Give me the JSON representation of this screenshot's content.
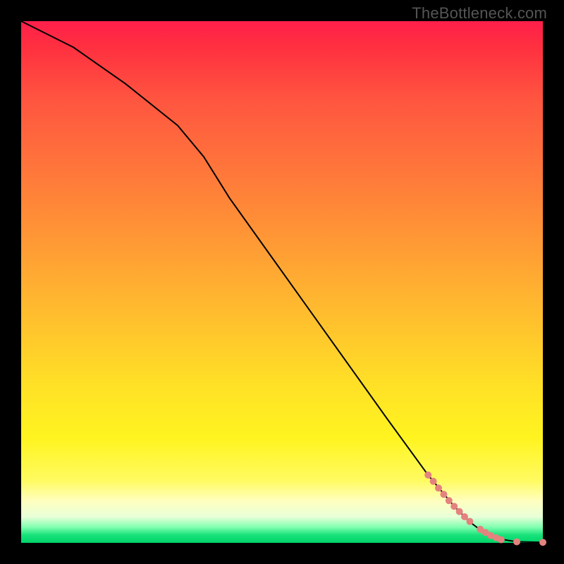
{
  "watermark": "TheBottleneck.com",
  "colors": {
    "line": "#000000",
    "dot_fill": "#e4827e",
    "dot_stroke": "#c96a65"
  },
  "chart_data": {
    "type": "line",
    "title": "",
    "xlabel": "",
    "ylabel": "",
    "xlim": [
      0,
      100
    ],
    "ylim": [
      0,
      100
    ],
    "grid": false,
    "series": [
      {
        "name": "curve",
        "x": [
          0,
          10,
          20,
          30,
          35,
          40,
          50,
          60,
          70,
          78,
          83,
          86,
          88,
          90,
          92,
          95,
          100
        ],
        "y": [
          100,
          95,
          88,
          80,
          74,
          66,
          52,
          38,
          24,
          13,
          7,
          4,
          2.5,
          1.4,
          0.7,
          0.2,
          0.1
        ]
      }
    ],
    "dots": {
      "name": "highlighted-segment",
      "x": [
        78,
        79,
        80,
        81,
        82,
        83,
        84,
        85,
        86,
        88,
        89,
        90,
        91,
        92,
        95,
        100
      ],
      "y": [
        13,
        11.8,
        10.5,
        9.3,
        8.1,
        7.0,
        6.0,
        5.0,
        4.1,
        2.6,
        2.0,
        1.4,
        1.0,
        0.6,
        0.2,
        0.1
      ],
      "r": 5
    }
  }
}
